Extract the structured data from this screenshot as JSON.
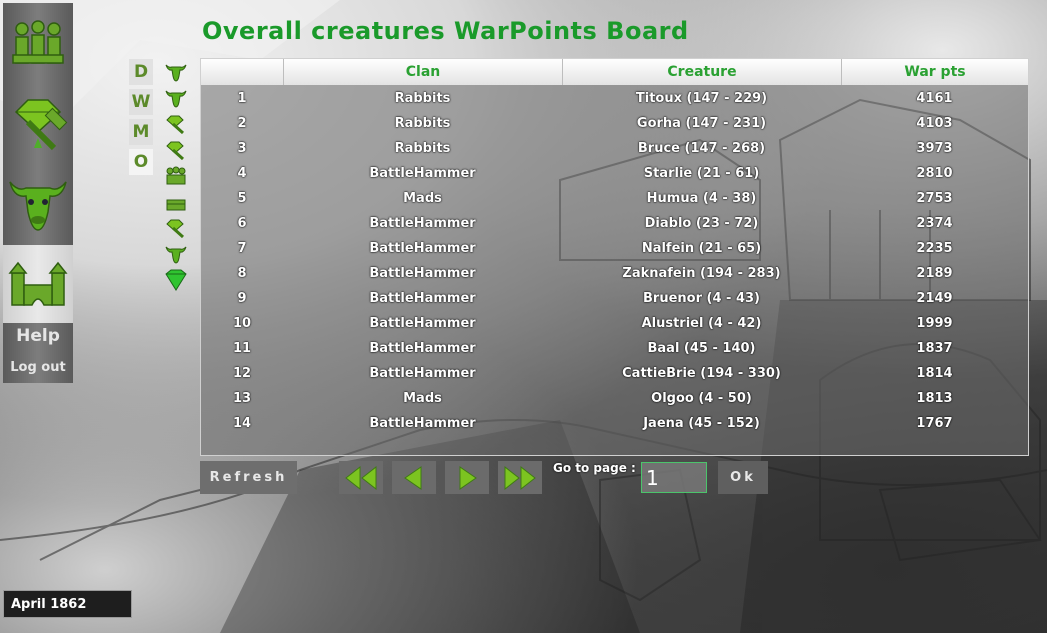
{
  "title": "Overall creatures WarPoints Board",
  "nav": {
    "help": "Help",
    "logout": "Log out"
  },
  "periods": [
    "D",
    "W",
    "M",
    "O"
  ],
  "table": {
    "headers": [
      "",
      "Clan",
      "Creature",
      "War pts"
    ],
    "rows": [
      {
        "rank": "1",
        "clan": "Rabbits",
        "creature": "Titoux  (147 - 229)",
        "pts": "4161"
      },
      {
        "rank": "2",
        "clan": "Rabbits",
        "creature": "Gorha  (147 - 231)",
        "pts": "4103"
      },
      {
        "rank": "3",
        "clan": "Rabbits",
        "creature": "Bruce  (147 - 268)",
        "pts": "3973"
      },
      {
        "rank": "4",
        "clan": "BattleHammer",
        "creature": "Starlie  (21 - 61)",
        "pts": "2810"
      },
      {
        "rank": "5",
        "clan": "Mads",
        "creature": "Humua  (4 - 38)",
        "pts": "2753"
      },
      {
        "rank": "6",
        "clan": "BattleHammer",
        "creature": "Diablo  (23 - 72)",
        "pts": "2374"
      },
      {
        "rank": "7",
        "clan": "BattleHammer",
        "creature": "Nalfein  (21 - 65)",
        "pts": "2235"
      },
      {
        "rank": "8",
        "clan": "BattleHammer",
        "creature": "Zaknafein  (194 - 283)",
        "pts": "2189"
      },
      {
        "rank": "9",
        "clan": "BattleHammer",
        "creature": "Bruenor  (4 - 43)",
        "pts": "2149"
      },
      {
        "rank": "10",
        "clan": "BattleHammer",
        "creature": "Alustriel  (4 - 42)",
        "pts": "1999"
      },
      {
        "rank": "11",
        "clan": "BattleHammer",
        "creature": "Baal  (45 - 140)",
        "pts": "1837"
      },
      {
        "rank": "12",
        "clan": "BattleHammer",
        "creature": "CattieBrie  (194 - 330)",
        "pts": "1814"
      },
      {
        "rank": "13",
        "clan": "Mads",
        "creature": "Olgoo  (4 - 50)",
        "pts": "1813"
      },
      {
        "rank": "14",
        "clan": "BattleHammer",
        "creature": "Jaena  (45 - 152)",
        "pts": "1767"
      }
    ]
  },
  "pager": {
    "refresh": "Refresh",
    "goto_label": "Go to page :",
    "page_value": "1",
    "ok": "Ok"
  },
  "date": "April 1862",
  "colors": {
    "accent": "#1a9a2a",
    "icon_green": "#7cc420"
  }
}
